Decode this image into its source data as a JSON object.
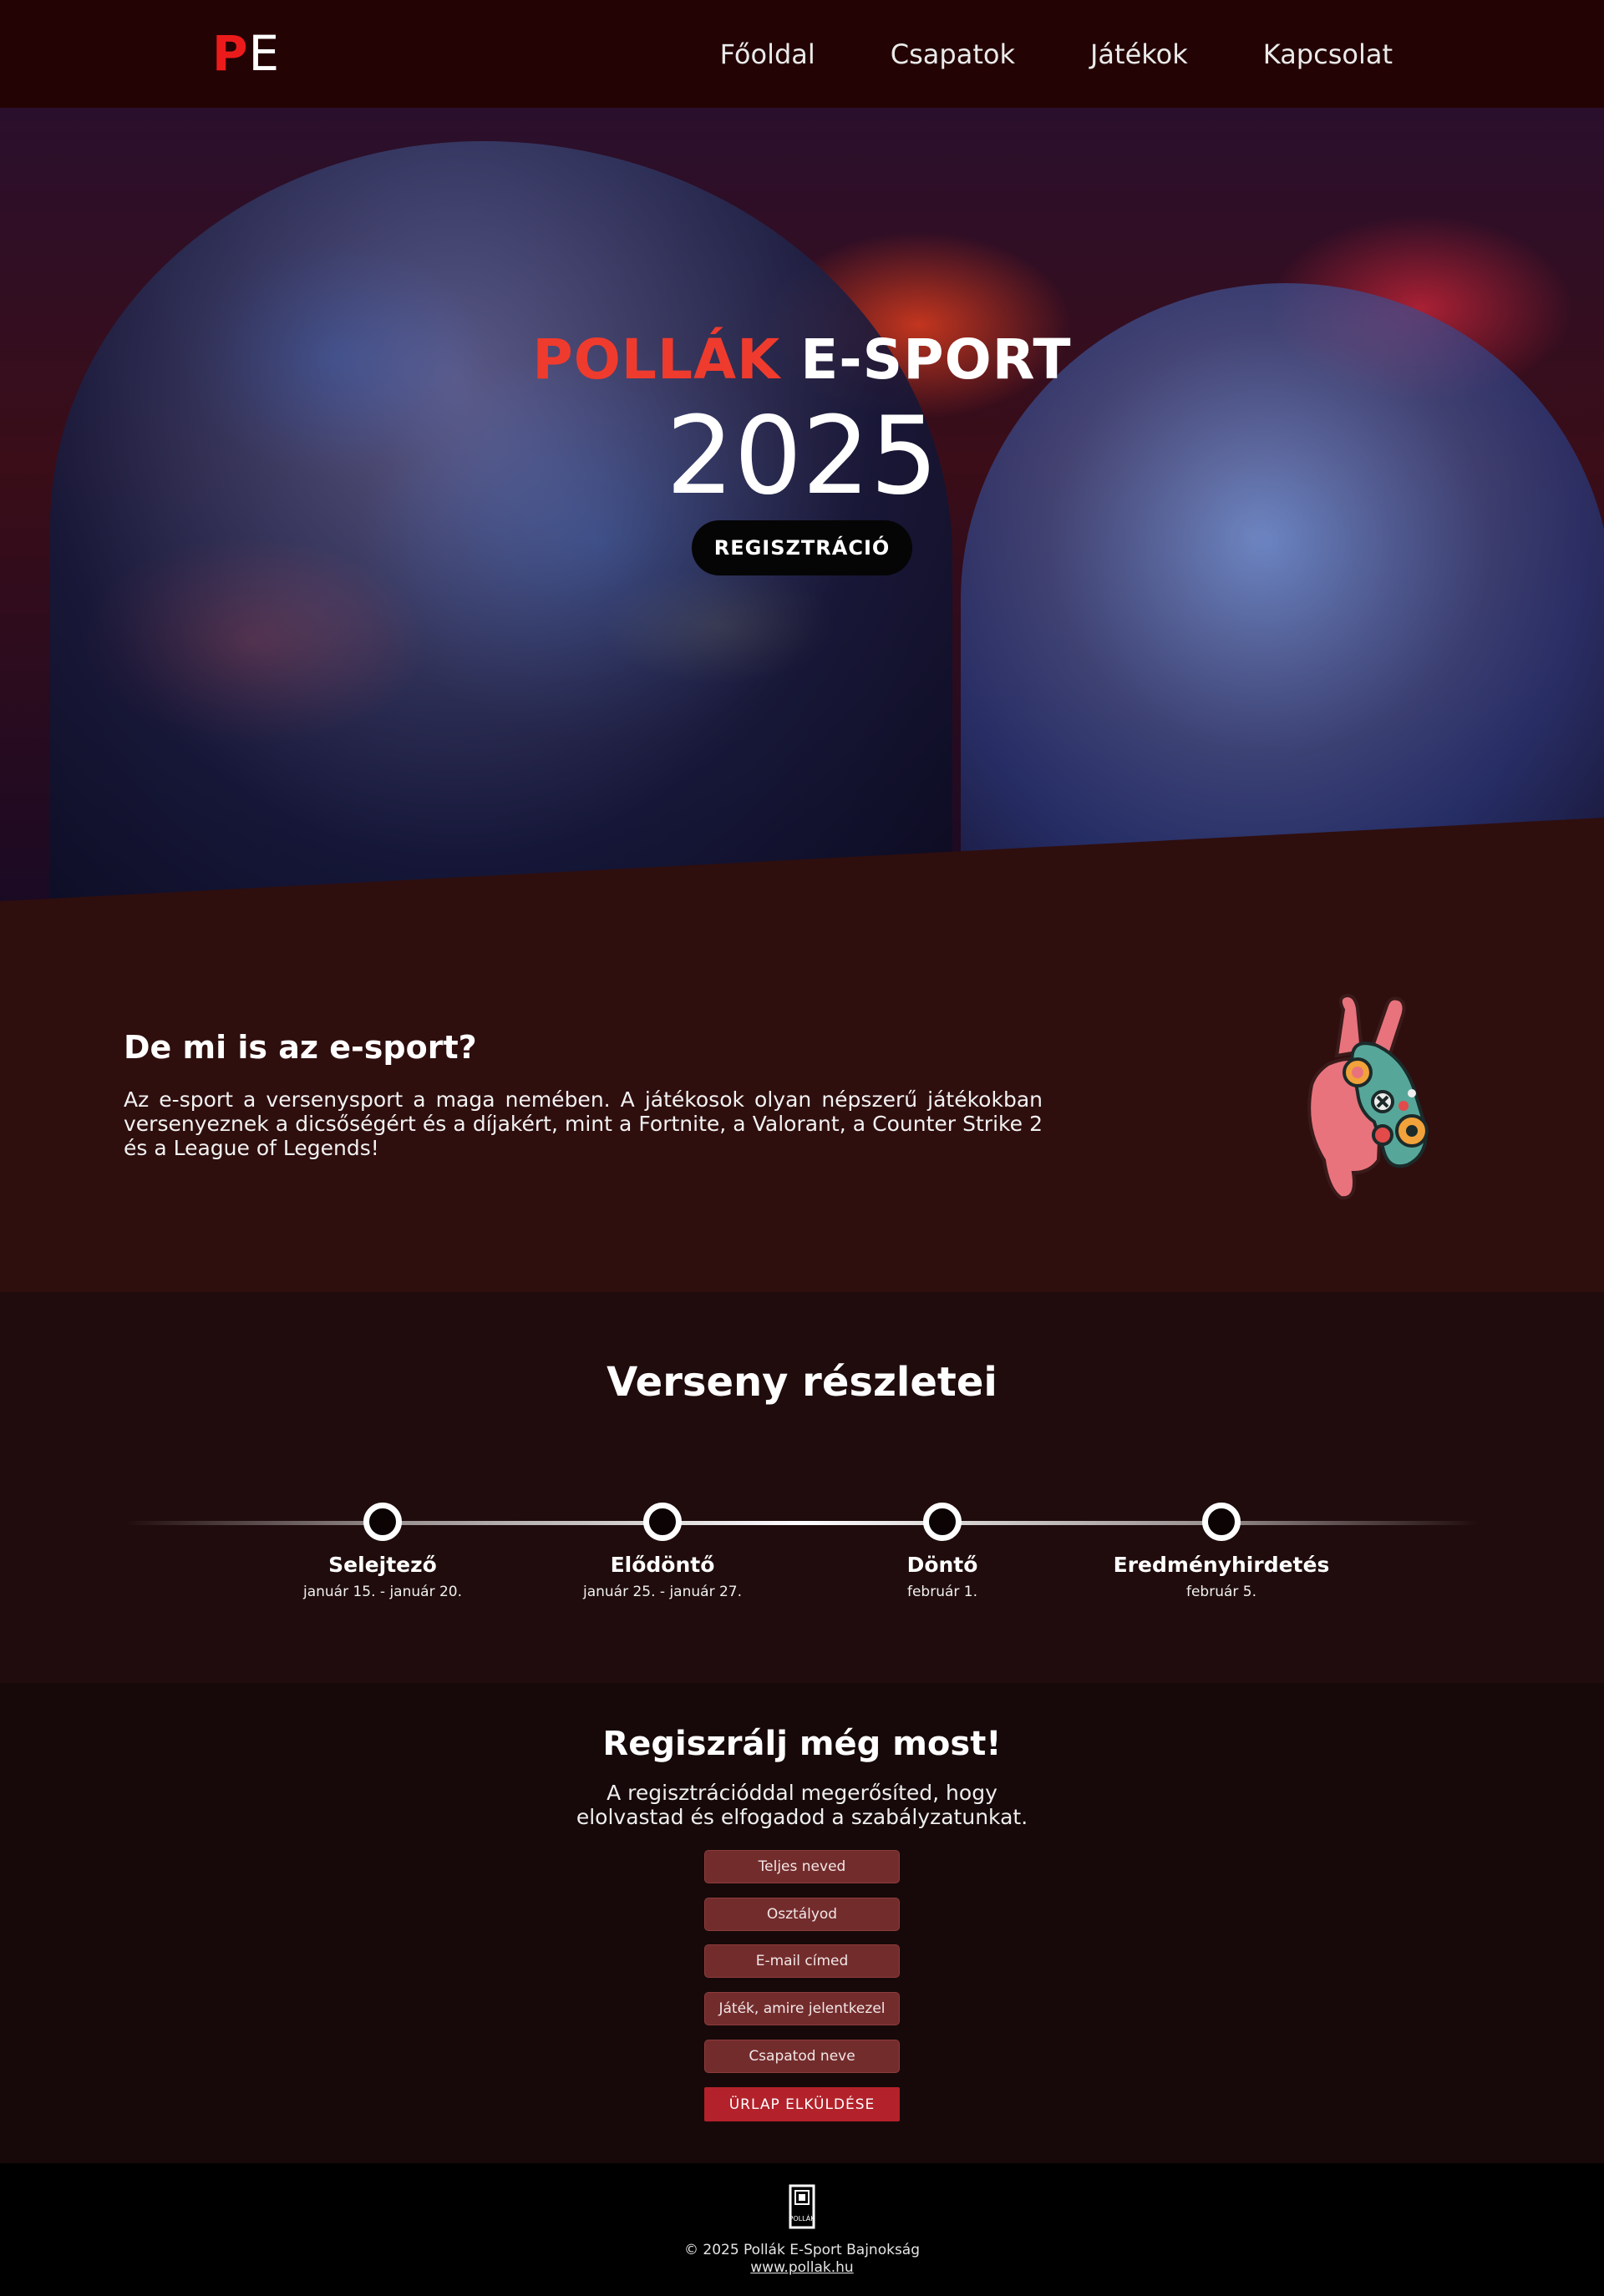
{
  "nav": {
    "logo_p": "P",
    "logo_e": "E",
    "items": [
      "Főoldal",
      "Csapatok",
      "Játékok",
      "Kapcsolat"
    ]
  },
  "hero": {
    "title_red": "POLLÁK",
    "title_white": "E-SPORT",
    "year": "2025",
    "button": "REGISZTRÁCIÓ"
  },
  "about": {
    "heading": "De mi is az e-sport?",
    "text": "Az e-sport a versenysport a maga nemében. A játékosok olyan népszerű játékokban versenyeznek a dicsőségért és a díjakért, mint a Fortnite, a Valorant, a Counter Strike 2 és a League of Legends!",
    "icon": "peace-hand-controller-icon"
  },
  "details": {
    "heading": "Verseny részletei",
    "stages": [
      {
        "name": "Selejtező",
        "date": "január 15. - január 20."
      },
      {
        "name": "Elődöntő",
        "date": "január 25. - január 27."
      },
      {
        "name": "Döntő",
        "date": "február 1."
      },
      {
        "name": "Eredményhirdetés",
        "date": "február 5."
      }
    ]
  },
  "register": {
    "heading": "Regiszrálj még most!",
    "subtitle": "A regisztrációddal megerősíted, hogy elolvastad és elfogadod a szabályzatunkat.",
    "fields": [
      "Teljes neved",
      "Osztályod",
      "E-mail címed",
      "Játék, amire jelentkezel",
      "Csapatod neve"
    ],
    "submit": "ÜRLAP ELKÜLDÉSE"
  },
  "footer": {
    "logo_text": "POLLÁK",
    "copyright": "© 2025 Pollák E-Sport Bajnokság",
    "link": "www.pollak.hu"
  },
  "colors": {
    "nav_bg": "#240304",
    "accent_red": "#ef3b2d",
    "about_bg": "#2f0e0e",
    "details_bg": "#200c0c",
    "register_bg": "#170909",
    "field_bg": "#732c2c",
    "submit_bg": "#b3212a"
  }
}
